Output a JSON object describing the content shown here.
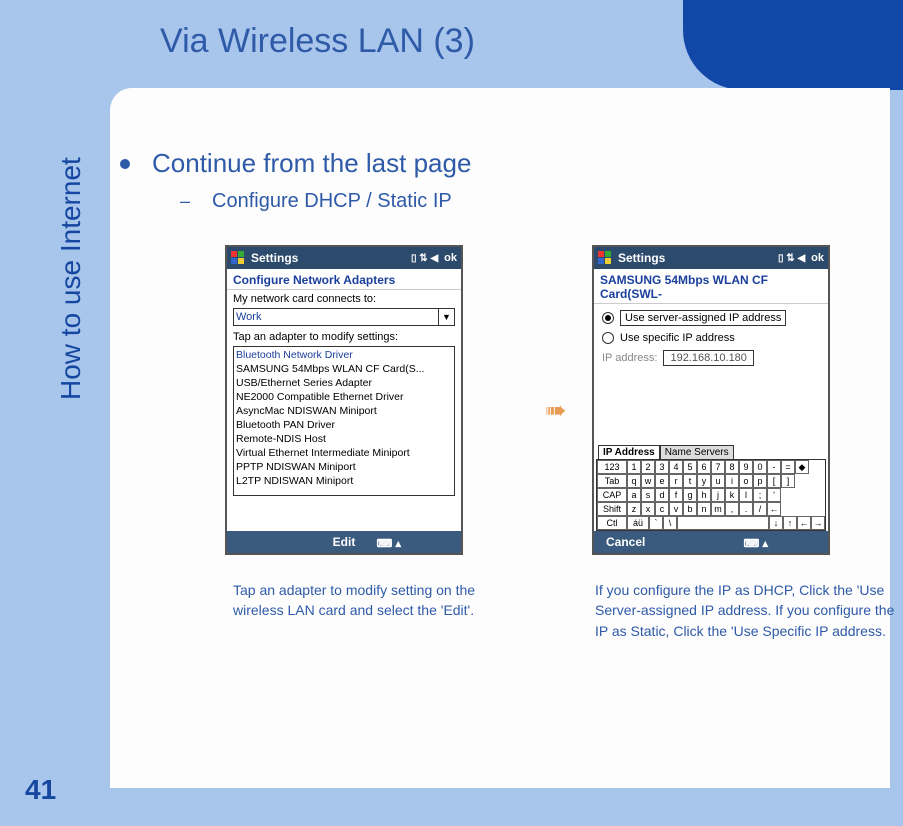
{
  "slide": {
    "title": "Via Wireless LAN (3)",
    "sidebar_label": "How to use Internet",
    "page_number": "41"
  },
  "bullets": {
    "main": "Continue from the last page",
    "sub": "Configure DHCP / Static IP"
  },
  "device_left": {
    "header_title": "Settings",
    "header_ok": "ok",
    "subtitle": "Configure Network Adapters",
    "label_connects": "My network card connects to:",
    "dropdown_value": "Work",
    "label_tap": "Tap an adapter to modify settings:",
    "adapters": [
      "Bluetooth Network Driver",
      "SAMSUNG 54Mbps WLAN CF Card(S...",
      "USB/Ethernet Series Adapter",
      "NE2000 Compatible Ethernet Driver",
      "AsyncMac NDISWAN Miniport",
      "Bluetooth PAN Driver",
      "Remote-NDIS Host",
      "Virtual Ethernet Intermediate Miniport",
      "PPTP NDISWAN Miniport",
      "L2TP NDISWAN Miniport"
    ],
    "footer": "Edit"
  },
  "device_right": {
    "header_title": "Settings",
    "header_ok": "ok",
    "subtitle": "SAMSUNG 54Mbps WLAN CF Card(SWL-",
    "radio1": "Use server-assigned IP address",
    "radio2": "Use specific IP address",
    "ip_label": "IP address:",
    "ip_value": "192.168.10.180",
    "tab1": "IP Address",
    "tab2": "Name Servers",
    "footer": "Cancel",
    "keyboard": {
      "r1": [
        "123",
        "1",
        "2",
        "3",
        "4",
        "5",
        "6",
        "7",
        "8",
        "9",
        "0",
        "-",
        "=",
        "◆"
      ],
      "r2": [
        "Tab",
        "q",
        "w",
        "e",
        "r",
        "t",
        "y",
        "u",
        "i",
        "o",
        "p",
        "[",
        "]"
      ],
      "r3": [
        "CAP",
        "a",
        "s",
        "d",
        "f",
        "g",
        "h",
        "j",
        "k",
        "l",
        ";",
        "'"
      ],
      "r4": [
        "Shift",
        "z",
        "x",
        "c",
        "v",
        "b",
        "n",
        "m",
        ",",
        ".",
        "/",
        "←"
      ],
      "r5": [
        "Ctl",
        "áü",
        "`",
        "\\",
        " ",
        "↓",
        "↑",
        "←",
        "→"
      ]
    }
  },
  "captions": {
    "left": "Tap an adapter to modify setting on the wireless LAN card and select the 'Edit'.",
    "right": "If you configure the IP as DHCP, Click the 'Use Server-assigned IP address. If you configure the IP as Static, Click the 'Use Specific IP address."
  }
}
